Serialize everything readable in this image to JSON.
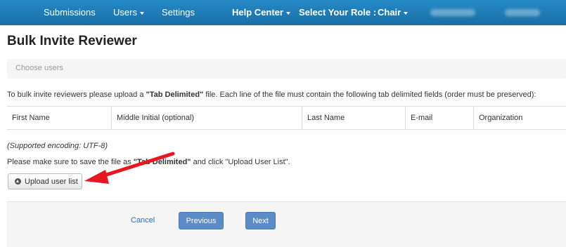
{
  "navbar": {
    "items": [
      {
        "label": "Submissions"
      },
      {
        "label": "Users"
      },
      {
        "label": "Settings"
      },
      {
        "label": "Help Center"
      },
      {
        "label": "Select Your Role :"
      },
      {
        "label": "Chair"
      }
    ]
  },
  "page": {
    "title": "Bulk Invite Reviewer",
    "breadcrumb": "Choose users",
    "instructions": {
      "prefix": "To bulk invite reviewers please upload a ",
      "highlight": "\"Tab Delimited\"",
      "suffix": " file. Each line of the file must contain the following tab delimited fields (order must be preserved):"
    },
    "fields": [
      "First Name",
      "Middle Initial (optional)",
      "Last Name",
      "E-mail",
      "Organization"
    ],
    "encoding_note": "(Supported encoding: UTF-8)",
    "save_note": {
      "prefix": "Please make sure to save the file as ",
      "highlight": "\"Tab Delimited\"",
      "suffix": " and click \"Upload User List\"."
    },
    "upload_button": "Upload user list"
  },
  "footer": {
    "cancel": "Cancel",
    "previous": "Previous",
    "next": "Next"
  },
  "colors": {
    "navbar": "#1f7dbb",
    "primary_button": "#5b8cc8",
    "annotation_arrow": "#e8171f"
  }
}
